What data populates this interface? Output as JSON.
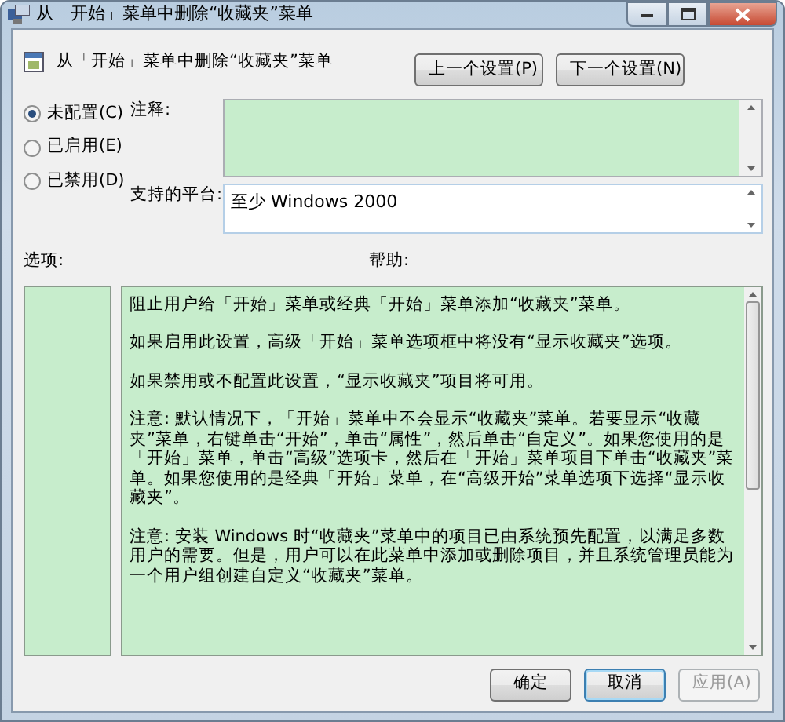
{
  "window": {
    "title": "从「开始」菜单中删除“收藏夹”菜单"
  },
  "header": {
    "title": "从「开始」菜单中删除“收藏夹”菜单",
    "buttons": [
      {
        "label": "上一个设置(P)"
      },
      {
        "label": "下一个设置(N)"
      }
    ]
  },
  "state_options": [
    {
      "label": "未配置(C)",
      "selected": true
    },
    {
      "label": "已启用(E)",
      "selected": false
    },
    {
      "label": "已禁用(D)",
      "selected": false
    }
  ],
  "comment": {
    "label": "注释:"
  },
  "platform": {
    "label": "支持的平台:",
    "value": "至少 Windows 2000"
  },
  "options": {
    "label": "选项:"
  },
  "help": {
    "label": "帮助:",
    "paragraphs": [
      "阻止用户给「开始」菜单或经典「开始」菜单添加“收藏夹”菜单。",
      "如果启用此设置，高级「开始」菜单选项框中将没有“显示收藏夹”选项。",
      "如果禁用或不配置此设置，“显示收藏夹”项目将可用。",
      "注意: 默认情况下，「开始」菜单中不会显示“收藏夹”菜单。若要显示“收藏夹”菜单，右键单击“开始”，单击“属性”，然后单击“自定义”。如果您使用的是「开始」菜单，单击“高级”选项卡，然后在「开始」菜单项目下单击“收藏夹”菜单。如果您使用的是经典「开始」菜单，在“高级开始”菜单选项下选择“显示收藏夹”。",
      "注意: 安装 Windows 时“收藏夹”菜单中的项目已由系统预先配置，以满足多数用户的需要。但是，用户可以在此菜单中添加或删除项目，并且系统管理员能为一个用户组创建自定义“收藏夹”菜单。"
    ]
  },
  "buttons": [
    {
      "label": "确定",
      "disabled": false,
      "focused": false
    },
    {
      "label": "取消",
      "disabled": false,
      "focused": true
    },
    {
      "label": "应用(A)",
      "disabled": true,
      "focused": false
    }
  ]
}
